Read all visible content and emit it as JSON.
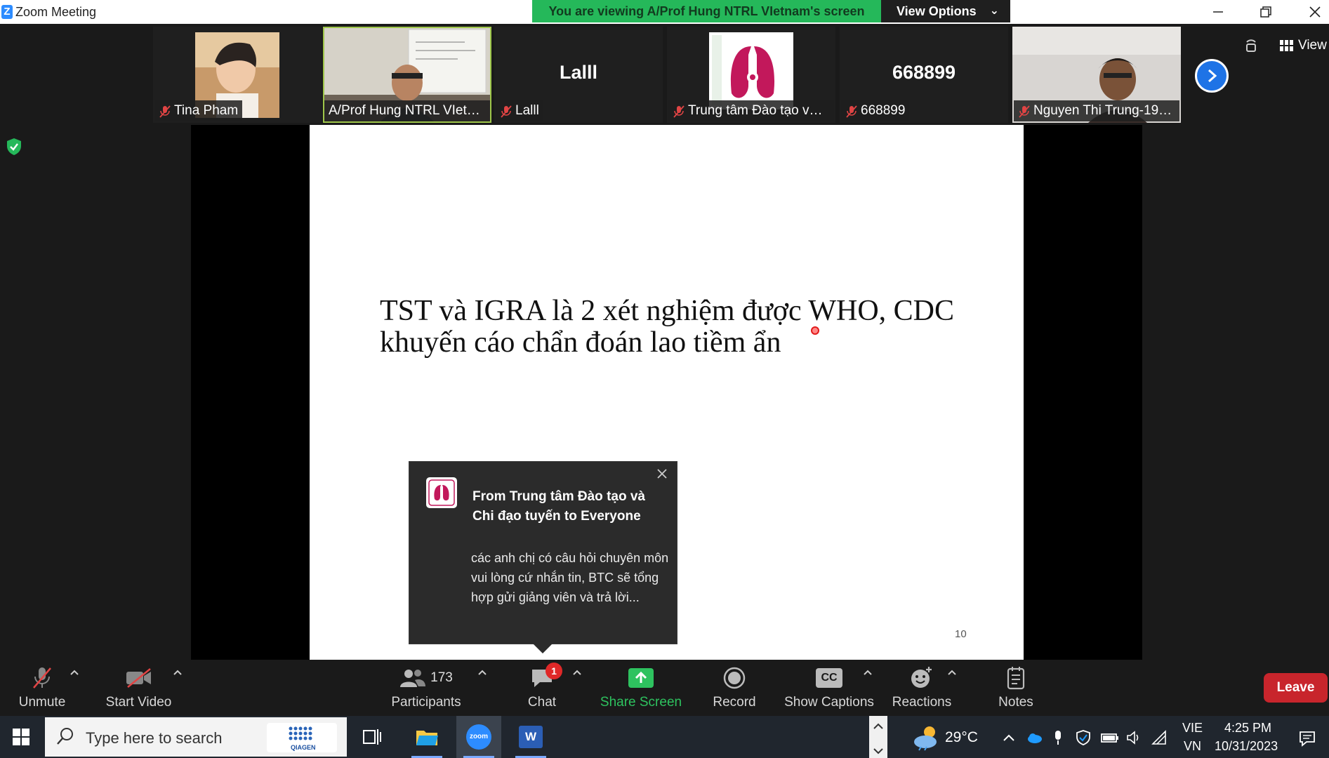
{
  "window": {
    "title": "Zoom Meeting",
    "logo_letter": "Z"
  },
  "share_banner": {
    "text": "You are viewing A/Prof Hung NTRL VIetnam's screen",
    "view_options_label": "View Options"
  },
  "participants_strip": [
    {
      "name": "Tina Pham",
      "kind": "video"
    },
    {
      "name": "A/Prof Hung NTRL VIetnam",
      "kind": "video",
      "active": true
    },
    {
      "name": "Lalll",
      "kind": "name"
    },
    {
      "name": "Trung tâm Đào tạo và ...",
      "kind": "logo"
    },
    {
      "name": "668899",
      "kind": "name"
    },
    {
      "name": "Nguyen Thi Trung-196...",
      "kind": "video"
    }
  ],
  "strip_big_names": {
    "t3": "Lalll",
    "t5": "668899"
  },
  "view_button_label": "View",
  "slide": {
    "line1": "TST và IGRA là 2 xét nghiệm được WHO, CDC",
    "line2": "khuyến cáo chẩn đoán lao tiềm ẩn",
    "page_number": "10"
  },
  "chat_popup": {
    "from": "From Trung tâm Đào tạo và Chi đạo tuyến to Everyone",
    "message": "các anh chị có câu hỏi chuyên môn vui lòng cứ nhắn tin, BTC sẽ tổng hợp gửi giảng viên và trả lời..."
  },
  "toolbar": {
    "unmute": "Unmute",
    "start_video": "Start Video",
    "participants": "Participants",
    "participants_count": "173",
    "chat": "Chat",
    "chat_badge": "1",
    "share_screen": "Share Screen",
    "record": "Record",
    "show_captions": "Show Captions",
    "captions_icon_text": "CC",
    "reactions": "Reactions",
    "notes": "Notes",
    "leave": "Leave"
  },
  "taskbar": {
    "search_placeholder": "Type here to search",
    "search_logo_text": "QIAGEN",
    "zoom_icon_text": "zoom",
    "word_icon_text": "W",
    "weather": "29°C",
    "language_line1": "VIE",
    "language_line2": "VN",
    "time": "4:25 PM",
    "date": "10/31/2023"
  },
  "colors": {
    "banner_green": "#25b85a",
    "active_border": "#9ec64a",
    "leave_red": "#c8252c",
    "share_green": "#2ec25f",
    "zoom_blue": "#2d8cff"
  }
}
